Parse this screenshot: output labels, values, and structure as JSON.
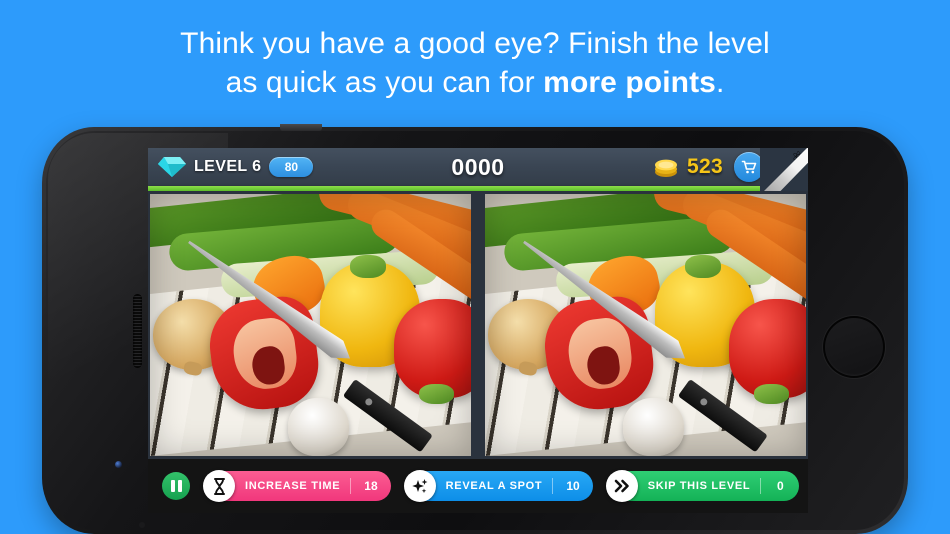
{
  "headline": {
    "line1": "Think you have a good eye? Finish the level",
    "line2_pre": "as quick as you can for ",
    "line2_strong": "more points",
    "line2_post": "."
  },
  "colors": {
    "background": "#2d9bfb",
    "header_bar": "#3a4553",
    "progress": "#6fcb34",
    "coin_gold": "#f5c518",
    "pink": "#f1377c",
    "blue": "#0d8ee8",
    "green": "#14b257",
    "gem_cyan": "#2ad6e6"
  },
  "game": {
    "header": {
      "gem_icon": "diamond-gem-icon",
      "level_label": "LEVEL 6",
      "level_badge": "80",
      "score": "0000",
      "coin_icon": "gold-coin-icon",
      "coin_count": "523",
      "cart_icon": "shopping-cart-icon",
      "page_curl_icon": "atom-icon"
    },
    "progress_percent": 100,
    "images": {
      "left_alt": "vegetables-photo-left",
      "right_alt": "vegetables-photo-right"
    },
    "toolbar": {
      "pause_icon": "pause-icon",
      "buttons": [
        {
          "icon": "hourglass-icon",
          "label": "INCREASE TIME",
          "count": "18",
          "color": "pink"
        },
        {
          "icon": "sparkle-icon",
          "label": "REVEAL A SPOT",
          "count": "10",
          "color": "blue"
        },
        {
          "icon": "double-chevron-icon",
          "label": "SKIP THIS LEVEL",
          "count": "0",
          "color": "green"
        }
      ]
    }
  }
}
